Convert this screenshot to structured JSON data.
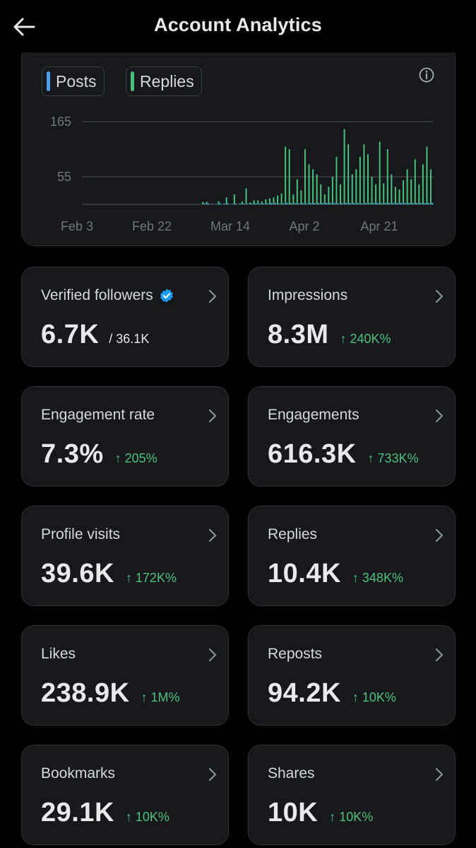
{
  "header": {
    "title": "Account Analytics",
    "back_icon": "arrow-left-icon"
  },
  "chart": {
    "legend": [
      {
        "label": "Posts",
        "color": "#4a9ef0"
      },
      {
        "label": "Replies",
        "color": "#46c07a"
      }
    ],
    "info_icon": "info-icon"
  },
  "chart_data": {
    "type": "bar",
    "yticks": [
      55,
      165
    ],
    "ylim": [
      0,
      185
    ],
    "grid": true,
    "xticks": [
      "Feb 3",
      "Feb 22",
      "Mar 14",
      "Apr 2",
      "Apr 21"
    ],
    "x": [
      "Feb 3",
      "Feb 4",
      "Feb 5",
      "Feb 6",
      "Feb 7",
      "Feb 8",
      "Feb 9",
      "Feb 10",
      "Feb 11",
      "Feb 12",
      "Feb 13",
      "Feb 14",
      "Feb 15",
      "Feb 16",
      "Feb 17",
      "Feb 18",
      "Feb 19",
      "Feb 20",
      "Feb 21",
      "Feb 22",
      "Feb 23",
      "Feb 24",
      "Feb 25",
      "Feb 26",
      "Feb 27",
      "Feb 28",
      "Feb 29",
      "Mar 1",
      "Mar 2",
      "Mar 3",
      "Mar 4",
      "Mar 5",
      "Mar 6",
      "Mar 7",
      "Mar 8",
      "Mar 9",
      "Mar 10",
      "Mar 11",
      "Mar 12",
      "Mar 13",
      "Mar 14",
      "Mar 15",
      "Mar 16",
      "Mar 17",
      "Mar 18",
      "Mar 19",
      "Mar 20",
      "Mar 21",
      "Mar 22",
      "Mar 23",
      "Mar 24",
      "Mar 25",
      "Mar 26",
      "Mar 27",
      "Mar 28",
      "Mar 29",
      "Mar 30",
      "Mar 31",
      "Apr 1",
      "Apr 2",
      "Apr 3",
      "Apr 4",
      "Apr 5",
      "Apr 6",
      "Apr 7",
      "Apr 8",
      "Apr 9",
      "Apr 10",
      "Apr 11",
      "Apr 12",
      "Apr 13",
      "Apr 14",
      "Apr 15",
      "Apr 16",
      "Apr 17",
      "Apr 18",
      "Apr 19",
      "Apr 20",
      "Apr 21",
      "Apr 22",
      "Apr 23",
      "Apr 24",
      "Apr 25",
      "Apr 26",
      "Apr 27",
      "Apr 28",
      "Apr 29",
      "Apr 30"
    ],
    "series": [
      {
        "name": "Posts",
        "values": [
          0,
          0,
          0,
          0,
          0,
          0,
          0,
          0,
          0,
          0,
          0,
          0,
          0,
          0,
          0,
          0,
          0,
          0,
          0,
          0,
          0,
          0,
          0,
          0,
          0,
          0,
          0,
          0,
          0,
          2,
          2,
          1,
          1,
          2,
          2,
          2,
          1,
          2,
          2,
          2,
          1,
          2,
          2,
          2,
          2,
          2,
          3,
          3,
          2,
          2,
          3,
          3,
          3,
          2,
          3,
          2,
          3,
          3,
          3,
          3,
          3,
          3,
          3,
          2,
          3,
          3,
          3,
          3,
          3,
          2,
          3,
          3,
          3,
          3,
          3,
          3,
          3,
          3,
          3,
          3,
          3,
          3,
          3,
          3,
          3,
          3,
          3,
          3
        ]
      },
      {
        "name": "Replies",
        "values": [
          0,
          0,
          0,
          0,
          0,
          0,
          0,
          0,
          0,
          0,
          0,
          0,
          0,
          0,
          0,
          0,
          0,
          0,
          0,
          0,
          0,
          0,
          0,
          0,
          0,
          0,
          0,
          0,
          0,
          5,
          5,
          0,
          0,
          6,
          0,
          14,
          0,
          20,
          0,
          6,
          32,
          4,
          8,
          8,
          6,
          10,
          12,
          14,
          18,
          22,
          115,
          110,
          20,
          50,
          28,
          110,
          80,
          70,
          60,
          40,
          20,
          35,
          55,
          95,
          40,
          150,
          120,
          60,
          70,
          95,
          120,
          100,
          55,
          40,
          125,
          42,
          110,
          60,
          35,
          30,
          48,
          70,
          50,
          90,
          40,
          80,
          115,
          70
        ]
      }
    ]
  },
  "stats": [
    {
      "label": "Verified followers",
      "value": "6.7K",
      "sub": "/ 36.1K",
      "change": "",
      "verified": true
    },
    {
      "label": "Impressions",
      "value": "8.3M",
      "sub": "",
      "change": "↑ 240K%"
    },
    {
      "label": "Engagement rate",
      "value": "7.3%",
      "sub": "",
      "change": "↑ 205%"
    },
    {
      "label": "Engagements",
      "value": "616.3K",
      "sub": "",
      "change": "↑ 733K%"
    },
    {
      "label": "Profile visits",
      "value": "39.6K",
      "sub": "",
      "change": "↑ 172K%"
    },
    {
      "label": "Replies",
      "value": "10.4K",
      "sub": "",
      "change": "↑ 348K%"
    },
    {
      "label": "Likes",
      "value": "238.9K",
      "sub": "",
      "change": "↑ 1M%"
    },
    {
      "label": "Reposts",
      "value": "94.2K",
      "sub": "",
      "change": "↑ 10K%"
    },
    {
      "label": "Bookmarks",
      "value": "29.1K",
      "sub": "",
      "change": "↑ 10K%"
    },
    {
      "label": "Shares",
      "value": "10K",
      "sub": "",
      "change": "↑ 10K%"
    }
  ],
  "colors": {
    "accent_green": "#4ec17e",
    "verified_blue": "#1d9bf0"
  }
}
